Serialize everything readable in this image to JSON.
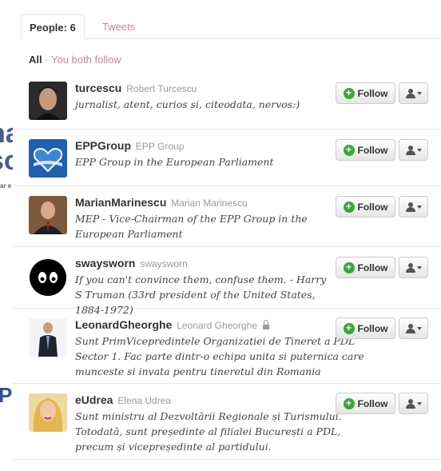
{
  "tabs": [
    {
      "label": "People: 6",
      "active": true
    },
    {
      "label": "Tweets",
      "active": false
    }
  ],
  "filter": {
    "all": "All",
    "separator": "·",
    "both": "You both follow"
  },
  "background_fragments": {
    "logo_line1": "na",
    "logo_line2": "so",
    "small_text": "ar e",
    "letter_p": "P"
  },
  "people": [
    {
      "screen_name": "turcescu",
      "full_name": "Robert Turcescu",
      "protected": false,
      "bio": "jurnalist, atent, curios si, citeodata, nervos:)",
      "follow_label": "Follow",
      "avatar_icon": "portrait-man-dark"
    },
    {
      "screen_name": "EPPGroup",
      "full_name": "EPP Group",
      "protected": false,
      "bio": "EPP Group in the European Parliament",
      "follow_label": "Follow",
      "avatar_icon": "epp-heart-logo"
    },
    {
      "screen_name": "MarianMarinescu",
      "full_name": "Marian Marinescu",
      "protected": false,
      "bio": "MEP - Vice-Chairman of the EPP Group in the European Parliament",
      "follow_label": "Follow",
      "avatar_icon": "portrait-man-suit"
    },
    {
      "screen_name": "swaysworn",
      "full_name": "swaysworn",
      "protected": false,
      "bio": "If you can't convince them, confuse them. - Harry S Truman (33rd president of the United States, 1884-1972)",
      "follow_label": "Follow",
      "avatar_icon": "black-face-eyes"
    },
    {
      "screen_name": "LeonardGheorghe",
      "full_name": "Leonard Gheorghe",
      "protected": true,
      "bio": "Sunt PrimVicepredintele Organizatiei de Tineret a PDL Sector 1. Fac parte dintr-o echipa unita si puternica care munceste si invata pentru tineretul din Romania",
      "follow_label": "Follow",
      "avatar_icon": "portrait-man-standing"
    },
    {
      "screen_name": "eUdrea",
      "full_name": "Elena Udrea",
      "protected": false,
      "bio": "Sunt ministru al Dezvoltării Regionale și Turismului. Totodată, sunt președinte al filialei București a PDL, precum și vicepreședinte al partidului.",
      "follow_label": "Follow",
      "avatar_icon": "portrait-woman-blonde"
    }
  ],
  "colors": {
    "accent_link": "#c6879c",
    "follow_plus": "#3aa83a",
    "logo_blue": "#4a5f8c"
  }
}
